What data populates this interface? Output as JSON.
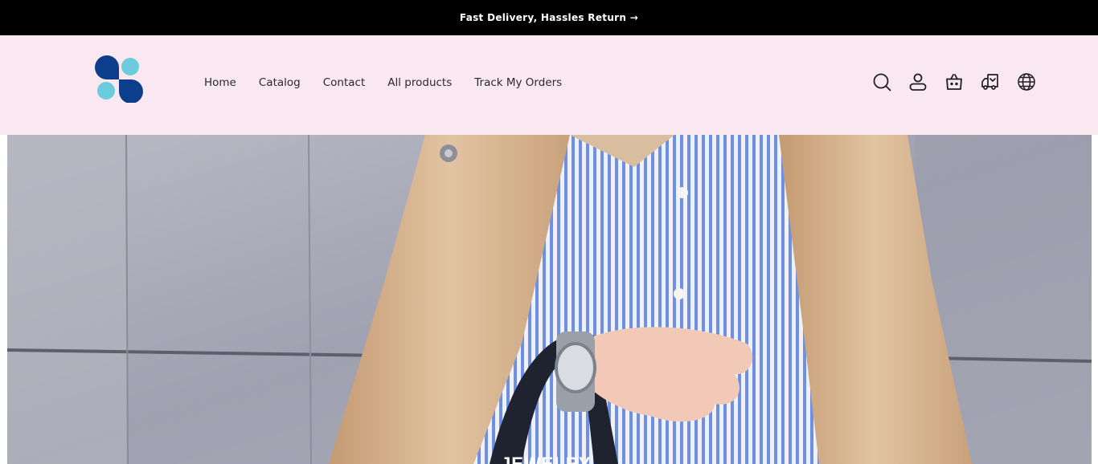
{
  "announcement": {
    "text": "Fast Delivery, Hassles Return →"
  },
  "header": {
    "logo_name": "store-logo",
    "nav": [
      {
        "label": "Home"
      },
      {
        "label": "Catalog"
      },
      {
        "label": "Contact"
      },
      {
        "label": "All products"
      },
      {
        "label": "Track My Orders"
      }
    ],
    "icons": [
      "search-icon",
      "account-icon",
      "cart-icon",
      "truck-icon",
      "globe-icon"
    ]
  },
  "hero": {
    "caption": "JEWELRY"
  },
  "colors": {
    "announcement_bg": "#000000",
    "header_bg": "#fae8f1",
    "logo_dark": "#0c3e8c",
    "logo_light": "#6ccbdd"
  }
}
